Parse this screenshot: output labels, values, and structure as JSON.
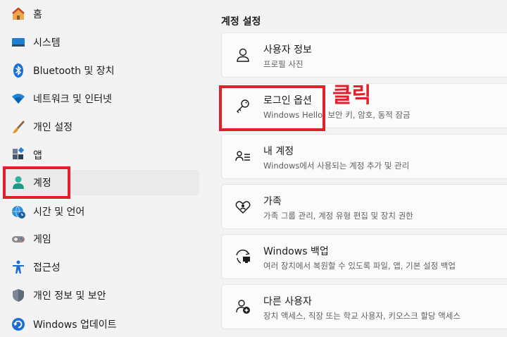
{
  "sidebar": {
    "items": [
      {
        "label": "홈",
        "icon": "home-icon"
      },
      {
        "label": "시스템",
        "icon": "monitor-icon"
      },
      {
        "label": "Bluetooth 및 장치",
        "icon": "bluetooth-icon"
      },
      {
        "label": "네트워크 및 인터넷",
        "icon": "wifi-icon"
      },
      {
        "label": "개인 설정",
        "icon": "brush-icon"
      },
      {
        "label": "앱",
        "icon": "apps-icon"
      },
      {
        "label": "계정",
        "icon": "account-icon",
        "selected": true
      },
      {
        "label": "시간 및 언어",
        "icon": "globe-clock-icon"
      },
      {
        "label": "게임",
        "icon": "gamepad-icon"
      },
      {
        "label": "접근성",
        "icon": "accessibility-icon"
      },
      {
        "label": "개인 정보 및 보안",
        "icon": "shield-icon"
      },
      {
        "label": "Windows 업데이트",
        "icon": "update-icon"
      }
    ]
  },
  "main": {
    "section_title": "계정 설정",
    "cards": [
      {
        "title": "사용자 정보",
        "subtitle": "프로필 사진",
        "icon": "user-icon"
      },
      {
        "title": "로그인 옵션",
        "subtitle": "Windows Hello, 보안 키, 암호, 동적 잠금",
        "icon": "key-icon"
      },
      {
        "title": "내 계정",
        "subtitle": "Windows에서 사용되는 계정 추가 및 관리",
        "icon": "user-list-icon"
      },
      {
        "title": "가족",
        "subtitle": "가족 그룹 관리, 계정 유형 편집 및 장치 권한",
        "icon": "family-heart-icon"
      },
      {
        "title": "Windows 백업",
        "subtitle": "여러 장치에서 복원할 수 있도록 파일, 앱, 기본 설정 백업",
        "icon": "backup-icon"
      },
      {
        "title": "다른 사용자",
        "subtitle": "장치 액세스, 직장 또는 학교 사용자, 키오스크 할당 액세스",
        "icon": "add-user-icon"
      }
    ]
  },
  "annotation": {
    "label": "클릭",
    "color": "#e0202a"
  },
  "colors": {
    "accent": "#0067c0",
    "annotation": "#e0202a",
    "background": "#f3f3f3"
  }
}
